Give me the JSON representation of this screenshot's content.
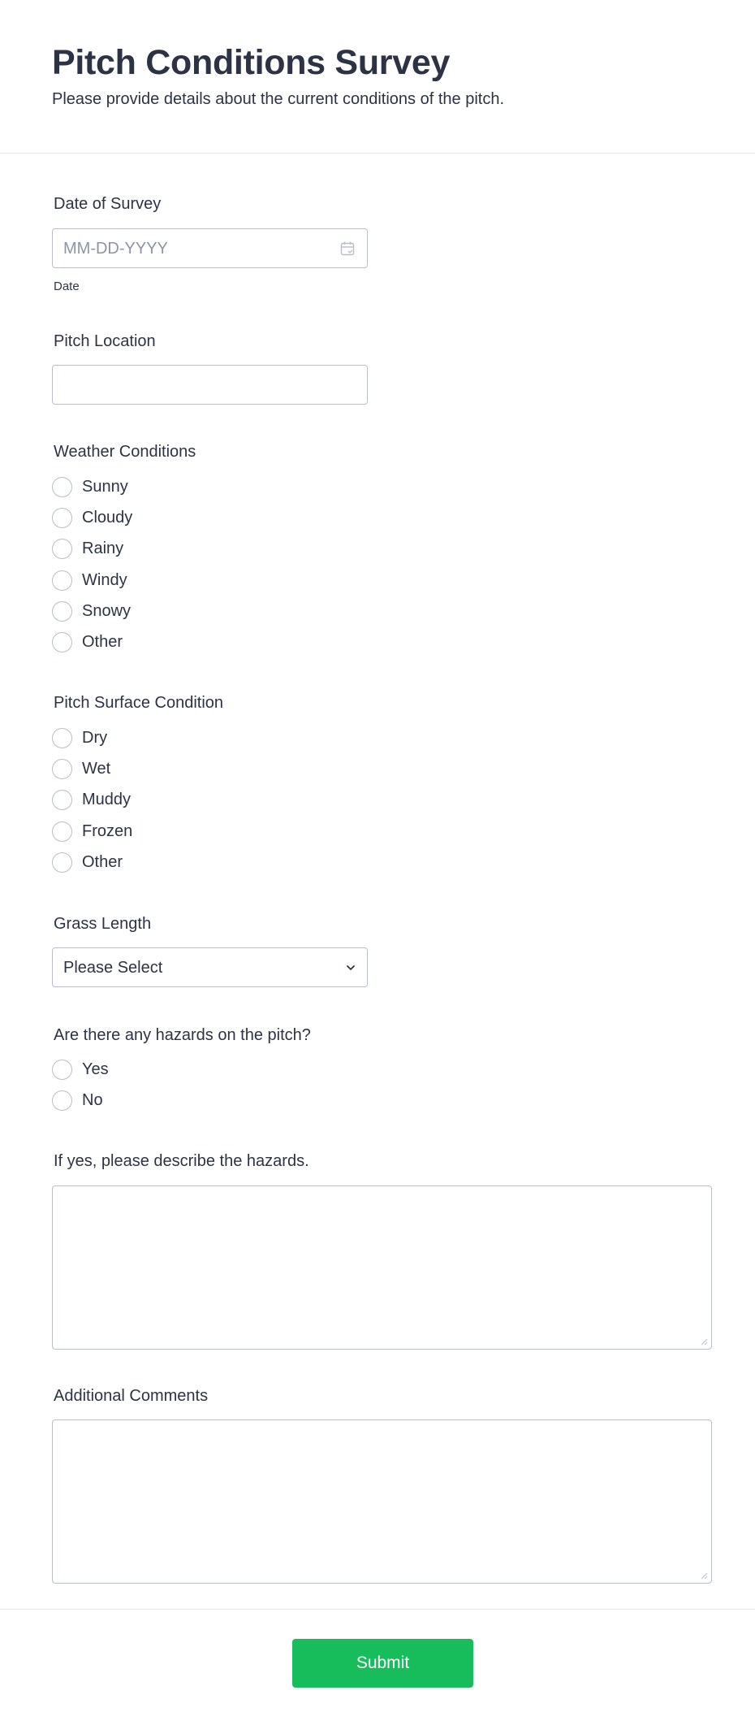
{
  "header": {
    "title": "Pitch Conditions Survey",
    "subtitle": "Please provide details about the current conditions of the pitch."
  },
  "date_field": {
    "label": "Date of Survey",
    "placeholder": "MM-DD-YYYY",
    "sublabel": "Date",
    "icon": "calendar-icon"
  },
  "location_field": {
    "label": "Pitch Location",
    "value": ""
  },
  "weather": {
    "label": "Weather Conditions",
    "options": [
      "Sunny",
      "Cloudy",
      "Rainy",
      "Windy",
      "Snowy",
      "Other"
    ]
  },
  "surface": {
    "label": "Pitch Surface Condition",
    "options": [
      "Dry",
      "Wet",
      "Muddy",
      "Frozen",
      "Other"
    ]
  },
  "grass": {
    "label": "Grass Length",
    "selected": "Please Select",
    "icon": "chevron-down-icon"
  },
  "hazards": {
    "label": "Are there any hazards on the pitch?",
    "options": [
      "Yes",
      "No"
    ]
  },
  "hazard_description": {
    "label": "If yes, please describe the hazards.",
    "value": ""
  },
  "comments": {
    "label": "Additional Comments",
    "value": ""
  },
  "submit": {
    "label": "Submit",
    "color": "#18bd5b"
  },
  "colors": {
    "text": "#2c3345",
    "border": "#b8bdc9",
    "placeholder": "#8d94a6",
    "divider": "#e3e5ea"
  }
}
